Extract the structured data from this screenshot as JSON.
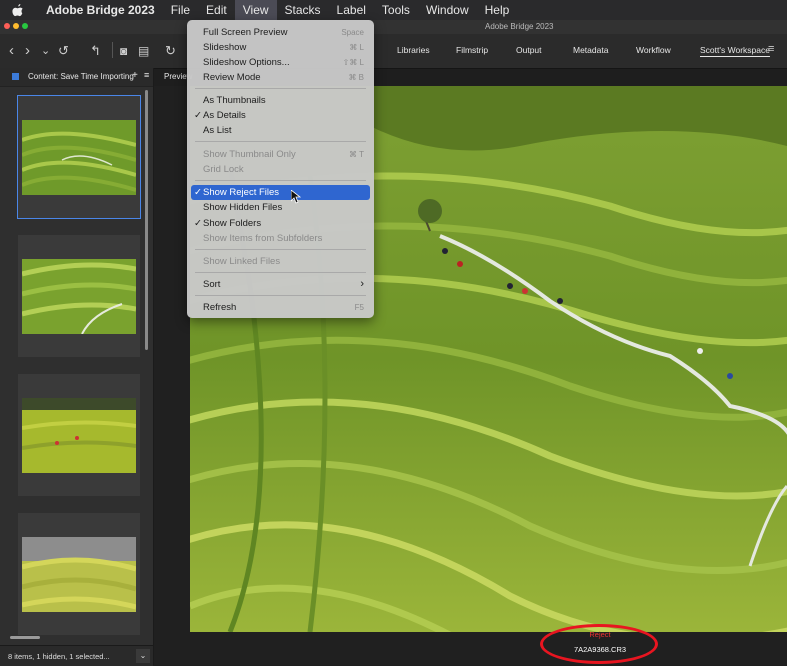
{
  "menubar": {
    "app_name": "Adobe Bridge 2023",
    "items": [
      "File",
      "Edit",
      "View",
      "Stacks",
      "Label",
      "Tools",
      "Window",
      "Help"
    ],
    "active": "View"
  },
  "window_title": "Adobe Bridge 2023",
  "workspaces": [
    "Libraries",
    "Filmstrip",
    "Output",
    "Metadata",
    "Workflow",
    "Scott's Workspace"
  ],
  "active_workspace": "Scott's Workspace",
  "content_panel": {
    "tab_label": "Content: Save Time Importing",
    "status_text": "8 items, 1 hidden, 1 selected..."
  },
  "preview_tab_label": "Preview",
  "preview": {
    "reject_label": "Reject",
    "filename": "7A2A9368.CR3"
  },
  "view_menu": {
    "items": [
      {
        "label": "Full Screen Preview",
        "shortcut": "Space"
      },
      {
        "label": "Slideshow",
        "shortcut": "⌘ L"
      },
      {
        "label": "Slideshow Options...",
        "shortcut": "⇧⌘ L"
      },
      {
        "label": "Review Mode",
        "shortcut": "⌘ B"
      },
      {
        "label": "As Thumbnails"
      },
      {
        "label": "As Details",
        "checked": true
      },
      {
        "label": "As List"
      },
      {
        "label": "Show Thumbnail Only",
        "shortcut": "⌘ T",
        "disabled": true
      },
      {
        "label": "Grid Lock",
        "disabled": true
      },
      {
        "label": "Show Reject Files",
        "checked": true,
        "highlighted": true
      },
      {
        "label": "Show Hidden Files"
      },
      {
        "label": "Show Folders",
        "checked": true
      },
      {
        "label": "Show Items from Subfolders",
        "disabled": true
      },
      {
        "label": "Show Linked Files",
        "disabled": true
      },
      {
        "label": "Sort",
        "submenu": true
      },
      {
        "label": "Refresh",
        "shortcut": "F5"
      }
    ]
  },
  "colors": {
    "accent_blue": "#2f66d0",
    "reject_red": "#e33333",
    "annotation_ring": "#e81520"
  }
}
